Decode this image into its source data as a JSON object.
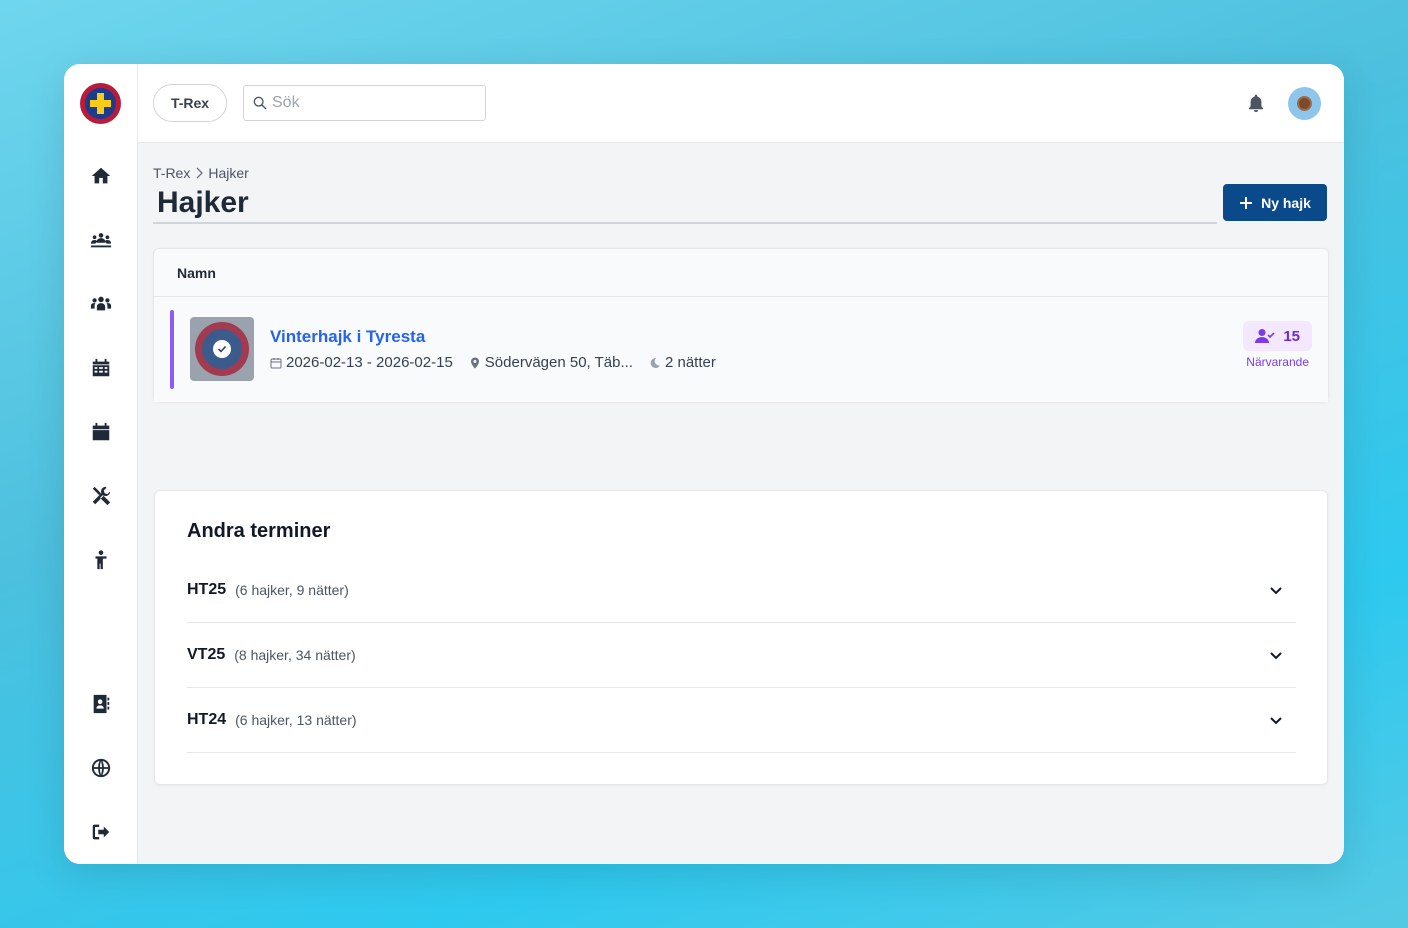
{
  "topbar": {
    "org_label": "T-Rex",
    "search_placeholder": "Sök"
  },
  "sidebar": {
    "items": [
      {
        "icon": "home-icon"
      },
      {
        "icon": "group-meeting-icon"
      },
      {
        "icon": "people-icon"
      },
      {
        "icon": "calendar-grid-icon"
      },
      {
        "icon": "calendar-icon"
      },
      {
        "icon": "tools-icon"
      },
      {
        "icon": "child-icon"
      },
      {
        "icon": "address-book-icon"
      },
      {
        "icon": "globe-icon"
      },
      {
        "icon": "logout-icon"
      }
    ]
  },
  "breadcrumb": {
    "parent": "T-Rex",
    "current": "Hajker"
  },
  "page": {
    "title": "Hajker",
    "new_button_label": "Ny hajk"
  },
  "hikes_table": {
    "column_header": "Namn",
    "rows": [
      {
        "name": "Vinterhajk i Tyresta",
        "dates": "2026-02-13 - 2026-02-15",
        "location": "Södervägen 50, Täb...",
        "nights": "2 nätter",
        "attendance_count": "15",
        "attendance_label": "Närvarande"
      }
    ]
  },
  "other_terms": {
    "title": "Andra terminer",
    "terms": [
      {
        "name": "HT25",
        "summary": "(6 hajker, 9 nätter)"
      },
      {
        "name": "VT25",
        "summary": "(8 hajker, 34 nätter)"
      },
      {
        "name": "HT24",
        "summary": "(6 hajker, 13 nätter)"
      }
    ]
  },
  "colors": {
    "primary_button": "#0b4a8a",
    "link": "#2563eb",
    "accent": "#8b5cf6",
    "attendance": "#6d28d9"
  }
}
